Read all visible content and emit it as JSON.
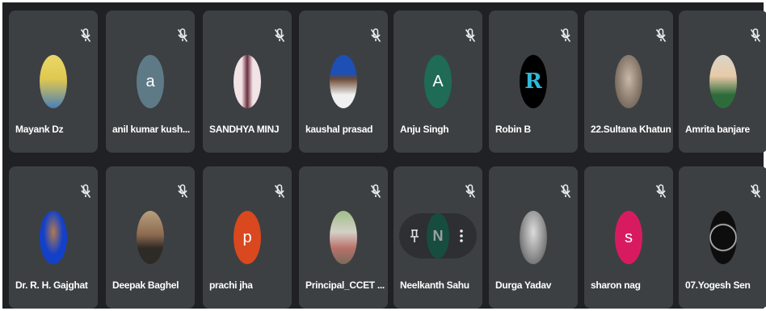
{
  "participants": [
    {
      "name": "Mayank Dz",
      "avatar": {
        "type": "photo",
        "colors": [
          "#e9d868",
          "#4a7fb8"
        ]
      }
    },
    {
      "name": "anil kumar kush...",
      "avatar": {
        "type": "letter",
        "letter": "a",
        "bg": "#5f7a87"
      }
    },
    {
      "name": "SANDHYA MINJ",
      "avatar": {
        "type": "photo",
        "colors": [
          "#f2e3e6",
          "#6b2d3d"
        ]
      }
    },
    {
      "name": "kaushal prasad",
      "avatar": {
        "type": "photo",
        "colors": [
          "#1d4fb5",
          "#f0f0f0"
        ]
      }
    },
    {
      "name": "Anju Singh",
      "avatar": {
        "type": "letter",
        "letter": "A",
        "bg": "#1f6b56"
      }
    },
    {
      "name": "Robin B",
      "avatar": {
        "type": "photo",
        "colors": [
          "#000000",
          "#2fb8d8"
        ]
      }
    },
    {
      "name": "22.Sultana Khatun",
      "avatar": {
        "type": "photo",
        "colors": [
          "#8a7b6e",
          "#c9b8a8"
        ]
      }
    },
    {
      "name": "Amrita banjare",
      "avatar": {
        "type": "photo",
        "colors": [
          "#d9d6c8",
          "#2d6b3a"
        ]
      }
    },
    {
      "name": "Dr. R. H. Gajghat",
      "avatar": {
        "type": "photo",
        "colors": [
          "#1340c8",
          "#1a1a1a"
        ]
      }
    },
    {
      "name": "Deepak Baghel",
      "avatar": {
        "type": "photo",
        "colors": [
          "#b7a07e",
          "#2e2a26"
        ]
      }
    },
    {
      "name": "prachi jha",
      "avatar": {
        "type": "letter",
        "letter": "p",
        "bg": "#d9481e"
      }
    },
    {
      "name": "Principal_CCET ...",
      "avatar": {
        "type": "photo",
        "colors": [
          "#9fbf8a",
          "#b8716b"
        ]
      }
    },
    {
      "name": "Neelkanth Sahu",
      "avatar": {
        "type": "hover",
        "letter": "N",
        "bg": "#174d3f"
      }
    },
    {
      "name": "Durga Yadav",
      "avatar": {
        "type": "photo",
        "colors": [
          "#8f8f8f",
          "#dcdcdc"
        ]
      }
    },
    {
      "name": "sharon nag",
      "avatar": {
        "type": "letter",
        "letter": "s",
        "bg": "#d81b60"
      }
    },
    {
      "name": "07.Yogesh Sen",
      "avatar": {
        "type": "photo",
        "colors": [
          "#0d0d0d",
          "#d8d8d8"
        ]
      }
    }
  ],
  "icons": {
    "muted": "mic-off-icon",
    "pin": "pin-icon",
    "more": "more-vert-icon"
  },
  "colors": {
    "stage_bg": "#202124",
    "tile_bg": "#3c4043",
    "text": "#ffffff"
  }
}
